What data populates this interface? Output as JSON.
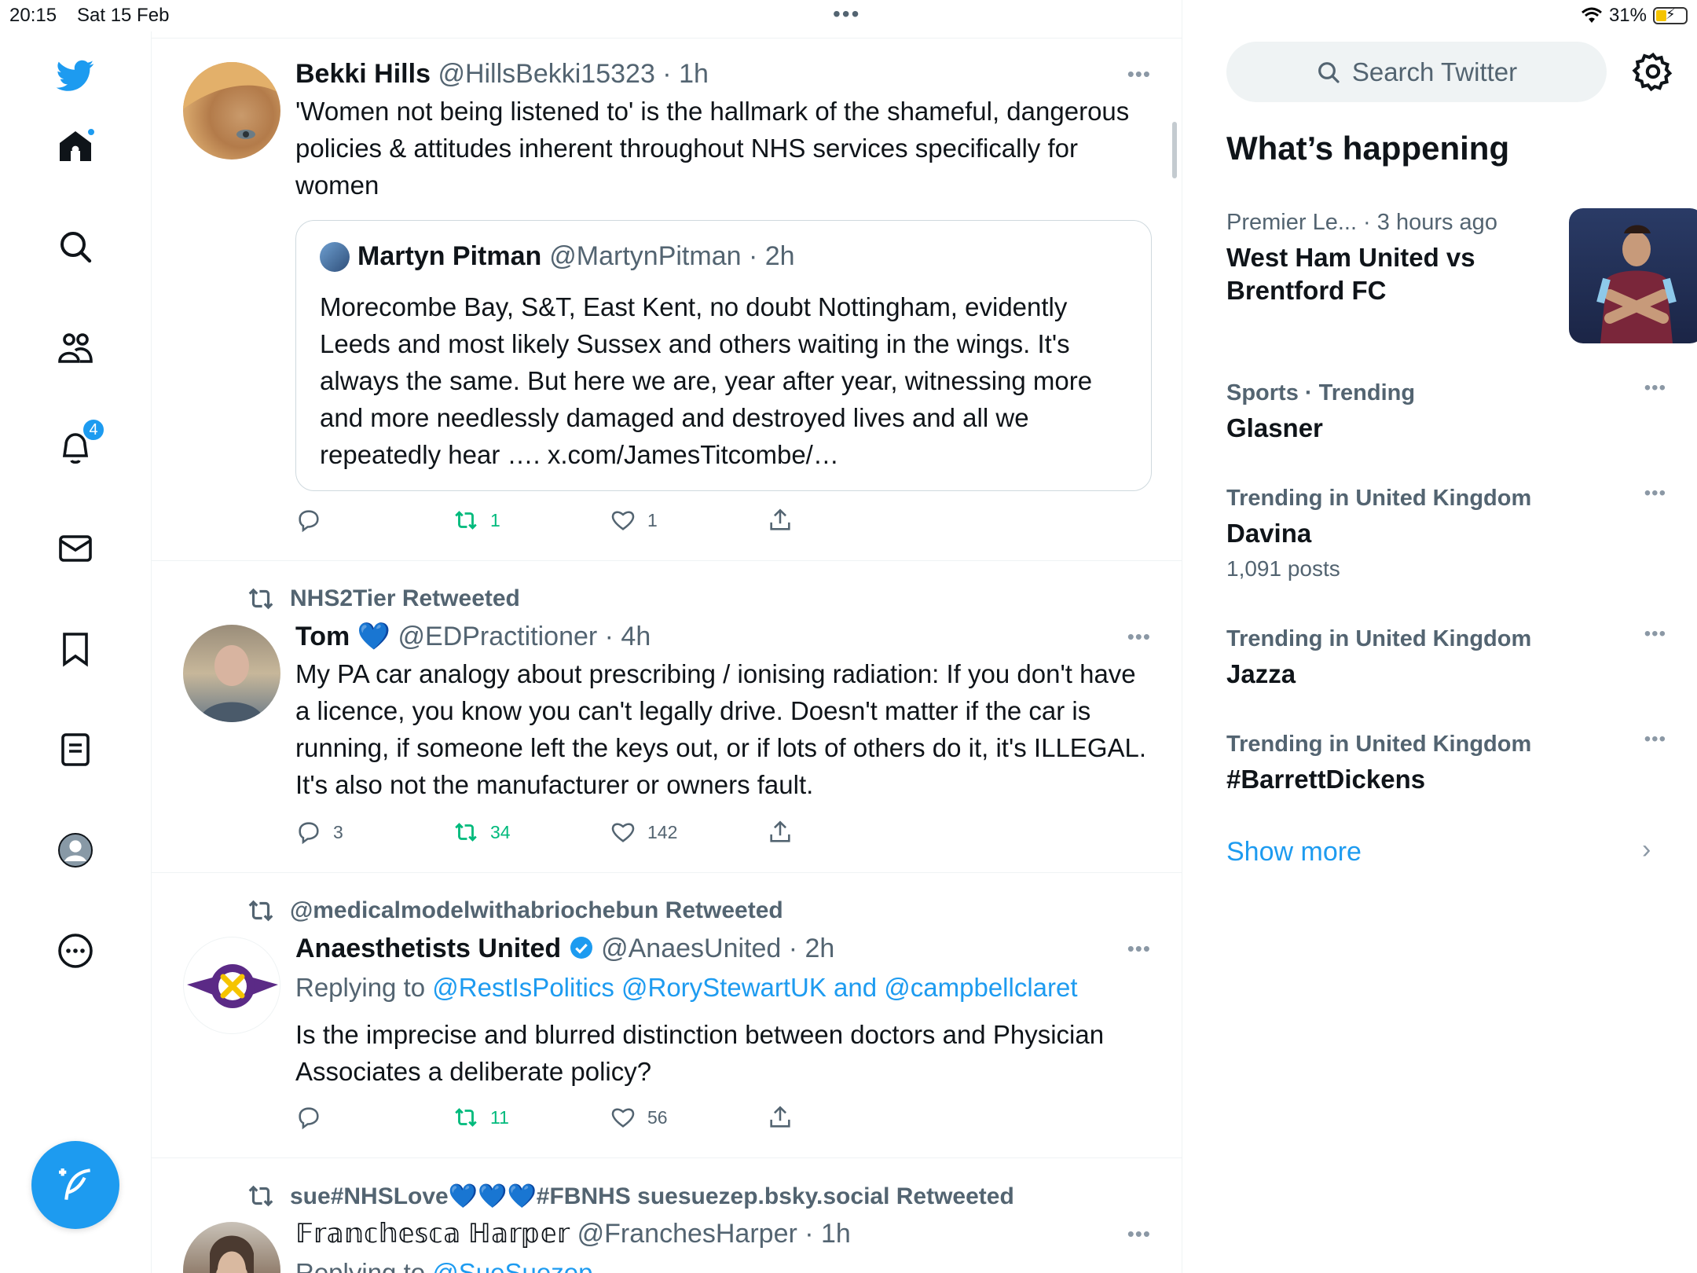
{
  "status_bar": {
    "time": "20:15",
    "date": "Sat 15 Feb",
    "battery": "31%"
  },
  "nav": {
    "notifications_badge": "4"
  },
  "tweets": [
    {
      "name": "Bekki Hills",
      "meta": "@HillsBekki15323 · 1h",
      "text": "'Women not being listened to' is the hallmark of the shameful, dangerous policies & attitudes inherent throughout NHS services specifically for women",
      "quote": {
        "name": "Martyn Pitman",
        "meta": "@MartynPitman · 2h",
        "text": "Morecombe Bay, S&T, East Kent, no doubt Nottingham, evidently Leeds and most likely Sussex and others waiting in the wings. It's always the same. But here we are, year after year, witnessing more and more needlessly damaged and destroyed lives and all we repeatedly hear …. x.com/JamesTitcombe/…"
      },
      "replies": "",
      "retweets": "1",
      "likes": "1"
    },
    {
      "retweeted_by": "NHS2Tier Retweeted",
      "name": "Tom",
      "name_emoji": "💙",
      "meta": "@EDPractitioner · 4h",
      "text": "My PA car analogy about prescribing / ionising radiation: If you don't have a licence, you know you can't legally drive. Doesn't matter if the car is running, if someone left the keys out, or if lots of others do it, it's ILLEGAL. It's also not the manufacturer or owners fault.",
      "replies": "3",
      "retweets": "34",
      "likes": "142"
    },
    {
      "retweeted_by": "@medicalmodelwithabriochebun Retweeted",
      "name": "Anaesthetists United",
      "meta": "@AnaesUnited · 2h",
      "replying_prefix": "Replying to",
      "replying_to": "@RestIsPolitics @RoryStewartUK and @campbellclaret",
      "text": "Is the imprecise and blurred distinction between doctors and Physician Associates a deliberate policy?",
      "replies": "",
      "retweets": "11",
      "likes": "56"
    },
    {
      "retweeted_by": "sue#NHSLove💙💙💙#FBNHS suesuezep.bsky.social Retweeted",
      "name": "𝔽𝕣𝕒𝕟𝕔𝕙𝕖𝕤𝕔𝕒 ℍ𝕒𝕣𝕡𝕖𝕣",
      "meta": "@FranchesHarper · 1h",
      "replying_prefix": "Replying to",
      "replying_to": "@SueSuezep"
    }
  ],
  "sidebar": {
    "search_placeholder": "Search Twitter",
    "section_title": "What’s happening",
    "trends": [
      {
        "meta": "Premier Le... · 3 hours ago",
        "title": "West Ham United vs Brentford FC",
        "posts": ""
      },
      {
        "meta": "Sports · Trending",
        "title": "Glasner",
        "posts": ""
      },
      {
        "meta": "Trending in United Kingdom",
        "title": "Davina",
        "posts": "1,091 posts"
      },
      {
        "meta": "Trending in United Kingdom",
        "title": "Jazza",
        "posts": ""
      },
      {
        "meta": "Trending in United Kingdom",
        "title": "#BarrettDickens",
        "posts": ""
      }
    ],
    "show_more": "Show more"
  },
  "colors": {
    "accent": "#1d9bf0",
    "retweet_green": "#00ba7c",
    "muted": "#536471"
  },
  "icons": [
    "twitter-logo-icon",
    "home-icon",
    "search-icon",
    "communities-icon",
    "bell-icon",
    "mail-icon",
    "bookmark-icon",
    "lists-icon",
    "profile-icon",
    "more-icon",
    "compose-icon",
    "reply-icon",
    "retweet-icon",
    "heart-icon",
    "share-icon",
    "gear-icon",
    "verified-icon"
  ]
}
